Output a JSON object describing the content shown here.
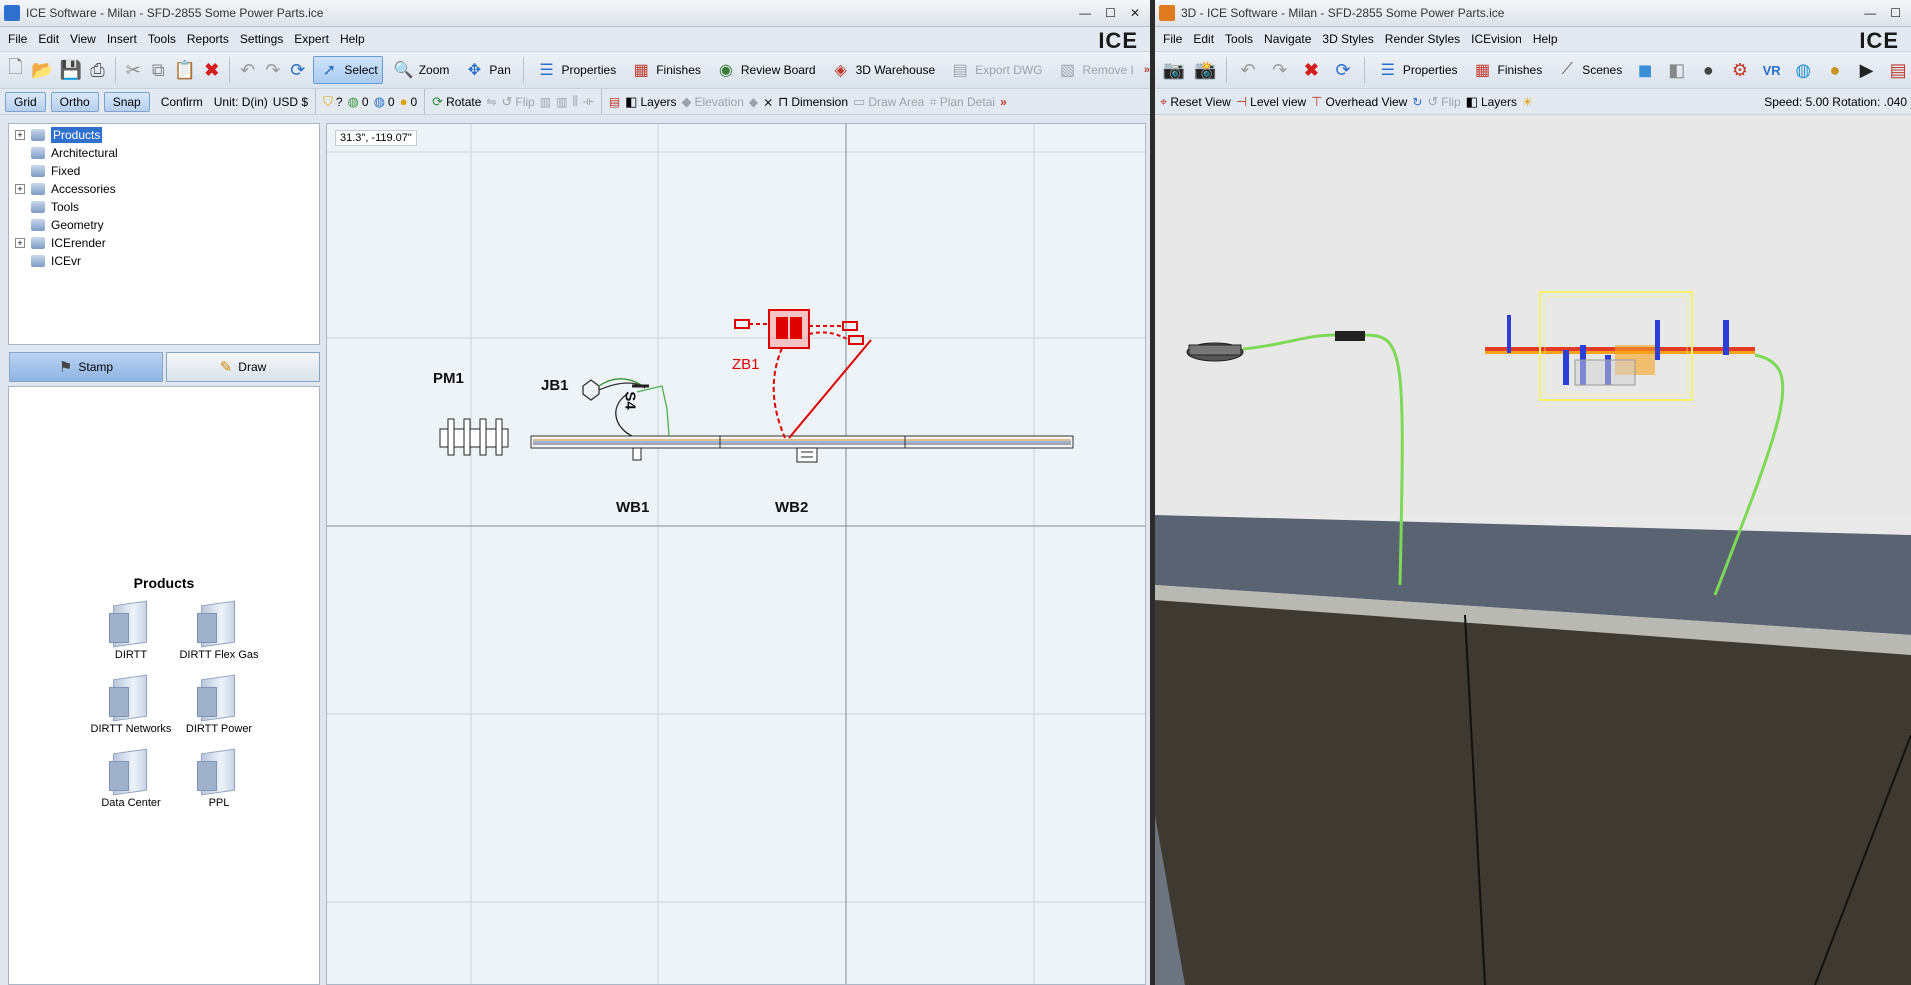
{
  "left_window": {
    "title": "ICE Software - Milan - SFD-2855 Some Power Parts.ice",
    "window_buttons": [
      "—",
      "☐",
      "✕"
    ],
    "menu": [
      "File",
      "Edit",
      "View",
      "Insert",
      "Tools",
      "Reports",
      "Settings",
      "Expert",
      "Help"
    ],
    "logo": "ICE",
    "toolbar": {
      "select": "Select",
      "zoom": "Zoom",
      "pan": "Pan",
      "properties": "Properties",
      "finishes": "Finishes",
      "review_board": "Review Board",
      "warehouse": "3D Warehouse",
      "export_dwg": "Export DWG",
      "remove": "Remove I",
      "more": "»"
    },
    "toolbar2": {
      "grid": "Grid",
      "ortho": "Ortho",
      "snap": "Snap",
      "confirm": "Confirm",
      "unit": "Unit: D(in)",
      "currency": "USD $",
      "q": "?",
      "c1": "0",
      "c2": "0",
      "c3": "0",
      "rotate": "Rotate",
      "flip": "Flip",
      "layers": "Layers",
      "elevation": "Elevation",
      "dimension": "Dimension",
      "draw_area": "Draw Area",
      "plan_detail": "Plan Detai",
      "more": "»"
    },
    "tree": [
      {
        "label": "Products",
        "expandable": true,
        "selected": true
      },
      {
        "label": "Architectural",
        "expandable": false
      },
      {
        "label": "Fixed",
        "expandable": false
      },
      {
        "label": "Accessories",
        "expandable": true
      },
      {
        "label": "Tools",
        "expandable": false
      },
      {
        "label": "Geometry",
        "expandable": false
      },
      {
        "label": "ICErender",
        "expandable": true
      },
      {
        "label": "ICEvr",
        "expandable": false
      }
    ],
    "mode": {
      "stamp": "Stamp",
      "draw": "Draw"
    },
    "catalog": {
      "title": "Products",
      "items": [
        "DIRTT",
        "DIRTT Flex Gas",
        "DIRTT Networks",
        "DIRTT Power",
        "Data Center",
        "PPL"
      ]
    },
    "drawing": {
      "coord": "31.3\", -119.07\"",
      "labels": {
        "pm1": "PM1",
        "jb1": "JB1",
        "s4": "S4",
        "zb1": "ZB1",
        "wb1": "WB1",
        "wb2": "WB2"
      }
    }
  },
  "right_window": {
    "title": "3D - ICE Software - Milan - SFD-2855 Some Power Parts.ice",
    "window_buttons": [
      "—",
      "☐"
    ],
    "menu": [
      "File",
      "Edit",
      "Tools",
      "Navigate",
      "3D Styles",
      "Render Styles",
      "ICEvision",
      "Help"
    ],
    "logo": "ICE",
    "toolbar": {
      "properties": "Properties",
      "finishes": "Finishes",
      "scenes": "Scenes",
      "more": "»"
    },
    "toolbar2": {
      "reset_view": "Reset View",
      "level_view": "Level view",
      "overhead_view": "Overhead View",
      "flip": "Flip",
      "layers": "Layers",
      "status": "Speed: 5.00 Rotation: .040"
    }
  },
  "colors": {
    "selection": "#2f6fce",
    "active_tool": "#a9cbf1",
    "zone_red": "#e00000",
    "cable_green": "#7ed957",
    "frame_yellow": "#f5f26a",
    "floor": "#3f3a31"
  }
}
